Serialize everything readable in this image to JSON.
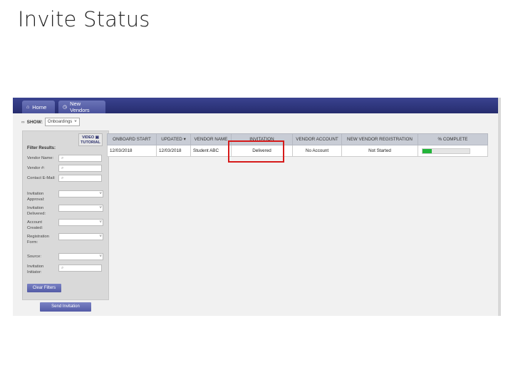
{
  "slide": {
    "title": "Invite Status"
  },
  "nav": {
    "tabs": [
      {
        "label": "Home",
        "icon": "home-icon"
      },
      {
        "label": "New Vendors",
        "icon": "clock-icon"
      }
    ]
  },
  "show": {
    "label": "SHOW:",
    "value": "Onboardings"
  },
  "filters": {
    "video_tutorial_line1": "VIDEO",
    "video_tutorial_line2": "TUTORIAL",
    "title": "Filter Results:",
    "vendor_name": "Vendor Name:",
    "vendor_number": "Vendor #:",
    "contact_email": "Contact E-Mail:",
    "invitation_approval": "Invitation Approval:",
    "invitation_delivered": "Invitation Delivered:",
    "account_created": "Account Created:",
    "registration_form": "Registration Form:",
    "source": "Source:",
    "invitation_initiator": "Invitation Initiator:",
    "clear_button": "Clear Filters",
    "send_button": "Send Invitation"
  },
  "table": {
    "headers": [
      "ONBOARD START",
      "UPDATED ▾",
      "VENDOR NAME",
      "INVITATION",
      "VENDOR ACCOUNT",
      "NEW VENDOR REGISTRATION",
      "% COMPLETE"
    ],
    "rows": [
      {
        "onboard_start": "12/03/2018",
        "updated": "12/03/2018",
        "vendor_name": "Student ABC",
        "invitation": "Delivered",
        "vendor_account": "No Account",
        "registration": "Not Started",
        "percent_complete": 0.2
      }
    ]
  },
  "colors": {
    "accent": "#2a3178",
    "progress": "#22b439",
    "highlight": "#d61a1a"
  }
}
